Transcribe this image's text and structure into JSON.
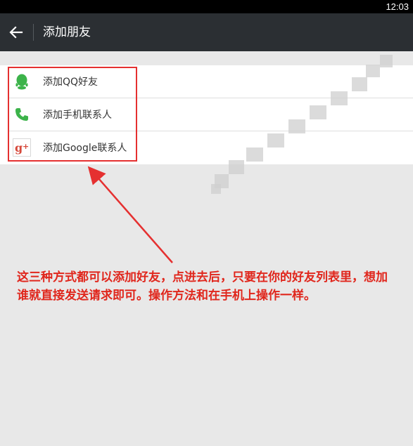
{
  "status_bar": {
    "time": "12:03"
  },
  "header": {
    "title": "添加朋友"
  },
  "options": [
    {
      "label": "添加QQ好友",
      "icon": "qq-icon"
    },
    {
      "label": "添加手机联系人",
      "icon": "phone-icon"
    },
    {
      "label": "添加Google联系人",
      "icon": "google-plus-icon"
    }
  ],
  "annotation": {
    "text": "这三种方式都可以添加好友，点进去后，只要在你的好友列表里，想加谁就直接发送请求即可。操作方法和在手机上操作一样。"
  },
  "colors": {
    "header_bg": "#2b2f33",
    "annotation_red": "#e0261c",
    "qq_green": "#3cb34a",
    "phone_green": "#3cb34a",
    "google_red": "#d6493b"
  }
}
